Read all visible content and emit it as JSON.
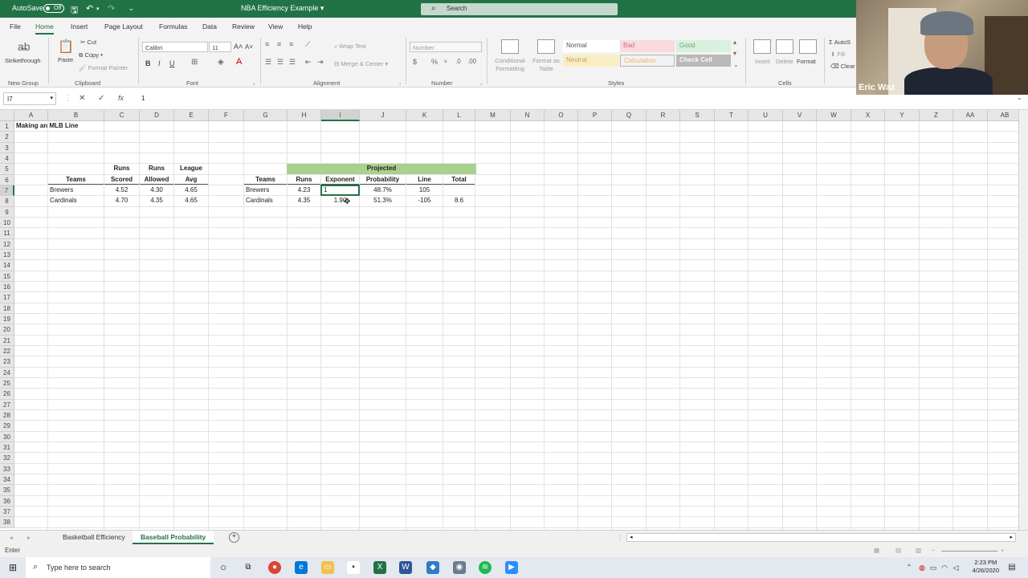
{
  "titlebar": {
    "autosave_label": "AutoSave",
    "autosave_state": "Off",
    "doc_title": "NBA Efficiency Example",
    "search_placeholder": "Search"
  },
  "ribbon_tabs": [
    "File",
    "Home",
    "Insert",
    "Page Layout",
    "Formulas",
    "Data",
    "Review",
    "View",
    "Help"
  ],
  "active_tab": "Home",
  "ribbon": {
    "strikethrough": "Strikethrough",
    "new_group": "New Group",
    "clipboard": {
      "paste": "Paste",
      "cut": "Cut",
      "copy": "Copy",
      "format_painter": "Format Painter",
      "label": "Clipboard"
    },
    "font": {
      "name": "Calibri",
      "size": "11",
      "bold": "B",
      "italic": "I",
      "underline": "U",
      "label": "Font"
    },
    "alignment": {
      "wrap_text": "Wrap Text",
      "merge_center": "Merge & Center",
      "label": "Alignment"
    },
    "number": {
      "format": "Number",
      "label": "Number"
    },
    "styles": {
      "conditional": "Conditional Formatting",
      "format_as_table": "Format as Table",
      "cells": [
        "Normal",
        "Bad",
        "Good",
        "Neutral",
        "Calculation",
        "Check Cell"
      ],
      "label": "Styles"
    },
    "cells_group": {
      "insert": "Insert",
      "delete": "Delete",
      "format": "Format",
      "label": "Cells"
    },
    "editing": {
      "autosum": "AutoS",
      "fill": "Fill",
      "clear": "Clear"
    }
  },
  "formula_bar": {
    "name_box": "I7",
    "cancel": "✕",
    "enter": "✓",
    "fx": "fx",
    "value": "1"
  },
  "columns": [
    "A",
    "B",
    "C",
    "D",
    "E",
    "F",
    "G",
    "H",
    "I",
    "J",
    "K",
    "L",
    "M",
    "N",
    "O",
    "P",
    "Q",
    "R",
    "S",
    "T",
    "U",
    "V",
    "W",
    "X",
    "Y",
    "Z",
    "AA",
    "AB"
  ],
  "selected_column": "I",
  "selected_row": 7,
  "row_count": 38,
  "sheet": {
    "A1": "Making an MLB Line",
    "C5": "Runs",
    "D5": "Runs",
    "E5": "League",
    "B6": "Teams",
    "C6": "Scored",
    "D6": "Allowed",
    "E6": "Avg",
    "B7": "Brewers",
    "C7": "4.52",
    "D7": "4.30",
    "E7": "4.65",
    "B8": "Cardinals",
    "C8": "4.70",
    "D8": "4.35",
    "E8": "4.65",
    "G5": "Projected",
    "G6": "Teams",
    "H6": "Runs",
    "I6": "Exponent",
    "J6": "Probability",
    "K6": "Line",
    "L6": "Total",
    "G7": "Brewers",
    "H7": "4.23",
    "I7": "1",
    "J7": "48.7%",
    "K7": "105",
    "G8": "Cardinals",
    "H8": "4.35",
    "I8": "1.90",
    "J8": "51.3%",
    "K8": "-105",
    "L8": "8.6"
  },
  "sheet_tabs": [
    "Basketball Efficiency",
    "Baseball Probability"
  ],
  "active_sheet": "Baseball Probability",
  "status_mode": "Enter",
  "taskbar": {
    "search_placeholder": "Type here to search",
    "time": "2:23 PM",
    "date": "4/26/2020"
  },
  "webcam": {
    "name": "Eric Waz"
  },
  "colors": {
    "excel_green": "#217346",
    "projected_fill": "#a9d08e"
  }
}
